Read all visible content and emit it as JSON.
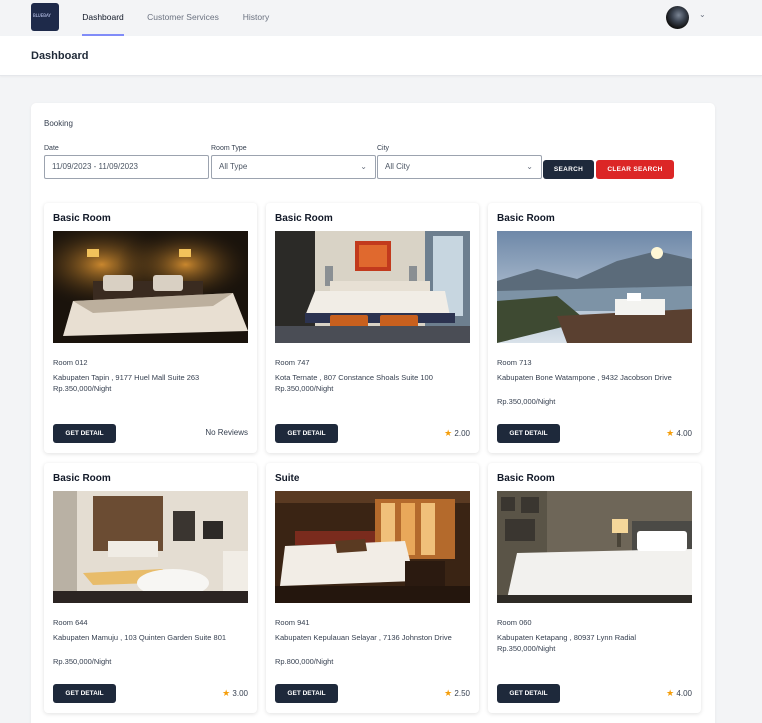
{
  "nav": {
    "logo_text": "BLUEBAY",
    "items": [
      {
        "label": "Dashboard",
        "active": true
      },
      {
        "label": "Customer Services",
        "active": false
      },
      {
        "label": "History",
        "active": false
      }
    ]
  },
  "page": {
    "title": "Dashboard"
  },
  "booking": {
    "heading": "Booking",
    "date": {
      "label": "Date",
      "value": "11/09/2023 - 11/09/2023"
    },
    "room_type": {
      "label": "Room Type",
      "value": "All Type"
    },
    "city": {
      "label": "City",
      "value": "All City"
    },
    "search_label": "SEARCH",
    "clear_label": "CLEAR SEARCH"
  },
  "rooms": [
    {
      "type": "Basic Room",
      "room": "Room 012",
      "address": "Kabupaten Tapin , 9177 Huel Mall Suite 263",
      "price": "Rp.350,000/Night",
      "rating_text": "No Reviews",
      "has_star": false
    },
    {
      "type": "Basic Room",
      "room": "Room 747",
      "address": "Kota Ternate , 807 Constance Shoals Suite 100",
      "price": "Rp.350,000/Night",
      "rating_text": "2.00",
      "has_star": true
    },
    {
      "type": "Basic Room",
      "room": "Room 713",
      "address": "Kabupaten Bone Watampone , 9432 Jacobson Drive",
      "price": "Rp.350,000/Night",
      "rating_text": "4.00",
      "has_star": true
    },
    {
      "type": "Basic Room",
      "room": "Room 644",
      "address": "Kabupaten Mamuju , 103 Quinten Garden Suite 801",
      "price": "Rp.350,000/Night",
      "rating_text": "3.00",
      "has_star": true
    },
    {
      "type": "Suite",
      "room": "Room 941",
      "address": "Kabupaten Kepulauan Selayar , 7136 Johnston Drive",
      "price": "Rp.800,000/Night",
      "rating_text": "2.50",
      "has_star": true
    },
    {
      "type": "Basic Room",
      "room": "Room 060",
      "address": "Kabupaten Ketapang , 80937 Lynn Radial",
      "price": "Rp.350,000/Night",
      "rating_text": "4.00",
      "has_star": true
    }
  ],
  "detail_label": "GET DETAIL",
  "colors": {
    "primary": "#1e293b",
    "danger": "#dc2626",
    "accent": "#818cf8",
    "star": "#f59e0b"
  }
}
